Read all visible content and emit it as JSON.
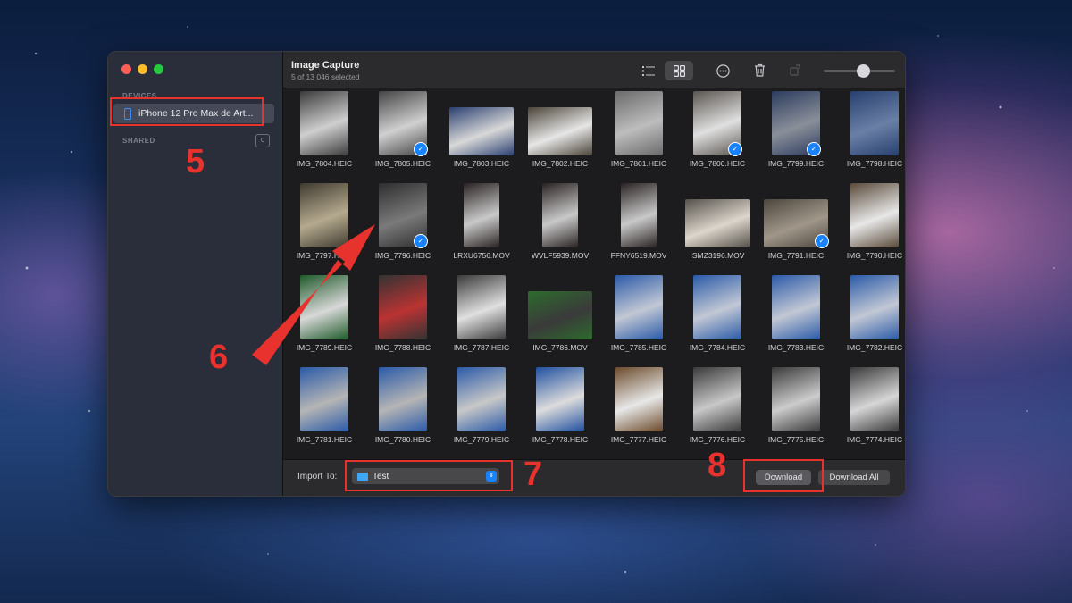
{
  "window": {
    "traffic_lights": [
      "#fe5f57",
      "#febc2e",
      "#28c840"
    ]
  },
  "sidebar": {
    "devices_header": "DEVICES",
    "device_name": "iPhone 12 Pro Max de Art...",
    "device_icon": "iphone-icon",
    "shared_header": "SHARED",
    "shared_count": "0"
  },
  "toolbar": {
    "title": "Image Capture",
    "subtitle": "5 of 13 046 selected",
    "icons": [
      "list-view-icon",
      "grid-view-icon",
      "more-icon",
      "trash-icon",
      "rotate-icon"
    ],
    "slider_level": 0.55
  },
  "accent": "#1a82ff",
  "photos": [
    {
      "label": "IMG_7804.HEIC",
      "selected": false,
      "shape": "portrait",
      "colors": [
        "#3b3b3b",
        "#cfcfcf"
      ]
    },
    {
      "label": "IMG_7805.HEIC",
      "selected": true,
      "shape": "portrait",
      "colors": [
        "#444",
        "#d0d0d0"
      ]
    },
    {
      "label": "IMG_7803.HEIC",
      "selected": false,
      "shape": "landscape",
      "colors": [
        "#2a3f70",
        "#d8d8d8"
      ]
    },
    {
      "label": "IMG_7802.HEIC",
      "selected": false,
      "shape": "landscape",
      "colors": [
        "#4a4338",
        "#e6e6e6"
      ]
    },
    {
      "label": "IMG_7801.HEIC",
      "selected": false,
      "shape": "portrait",
      "colors": [
        "#6a6a6a",
        "#bdbdbd"
      ]
    },
    {
      "label": "IMG_7800.HEIC",
      "selected": true,
      "shape": "portrait",
      "colors": [
        "#5a5550",
        "#e0e0e0"
      ]
    },
    {
      "label": "IMG_7799.HEIC",
      "selected": true,
      "shape": "portrait",
      "colors": [
        "#2c3c5e",
        "#8a8f99"
      ]
    },
    {
      "label": "IMG_7798.HEIC",
      "selected": false,
      "shape": "portrait",
      "colors": [
        "#27406e",
        "#6a7fa6"
      ]
    },
    {
      "label": "IMG_7797.HEIC",
      "selected": false,
      "shape": "portrait",
      "colors": [
        "#3f3a30",
        "#b5aa8f"
      ]
    },
    {
      "label": "IMG_7796.HEIC",
      "selected": true,
      "shape": "portrait",
      "colors": [
        "#2e2e2e",
        "#7a7a7a"
      ]
    },
    {
      "label": "LRXU6756.MOV",
      "selected": false,
      "shape": "tall",
      "colors": [
        "#2a2222",
        "#c9c9c9"
      ]
    },
    {
      "label": "WVLF5939.MOV",
      "selected": false,
      "shape": "tall",
      "colors": [
        "#2a2222",
        "#c9c9c9"
      ]
    },
    {
      "label": "FFNY6519.MOV",
      "selected": false,
      "shape": "tall",
      "colors": [
        "#2a2222",
        "#c9c9c9"
      ]
    },
    {
      "label": "ISMZ3196.MOV",
      "selected": false,
      "shape": "landscape",
      "colors": [
        "#55504a",
        "#dcd6cc"
      ]
    },
    {
      "label": "IMG_7791.HEIC",
      "selected": true,
      "shape": "landscape",
      "colors": [
        "#4c463d",
        "#a0978a"
      ]
    },
    {
      "label": "IMG_7790.HEIC",
      "selected": false,
      "shape": "portrait",
      "colors": [
        "#5a4a3a",
        "#e8e8e8"
      ]
    },
    {
      "label": "IMG_7789.HEIC",
      "selected": false,
      "shape": "portrait",
      "colors": [
        "#1e5a2a",
        "#d8d8d8"
      ]
    },
    {
      "label": "IMG_7788.HEIC",
      "selected": false,
      "shape": "portrait",
      "colors": [
        "#333",
        "#b33"
      ]
    },
    {
      "label": "IMG_7787.HEIC",
      "selected": false,
      "shape": "portrait",
      "colors": [
        "#3a3a3a",
        "#e0e0e0"
      ]
    },
    {
      "label": "IMG_7786.MOV",
      "selected": false,
      "shape": "landscape",
      "colors": [
        "#2d6b2d",
        "#3a3a3a"
      ]
    },
    {
      "label": "IMG_7785.HEIC",
      "selected": false,
      "shape": "portrait",
      "colors": [
        "#2b5aa8",
        "#c2c8d4"
      ]
    },
    {
      "label": "IMG_7784.HEIC",
      "selected": false,
      "shape": "portrait",
      "colors": [
        "#2b5aa8",
        "#c2c8d4"
      ]
    },
    {
      "label": "IMG_7783.HEIC",
      "selected": false,
      "shape": "portrait",
      "colors": [
        "#2b5aa8",
        "#c2c8d4"
      ]
    },
    {
      "label": "IMG_7782.HEIC",
      "selected": false,
      "shape": "portrait",
      "colors": [
        "#2b5aa8",
        "#c2c8d4"
      ]
    },
    {
      "label": "IMG_7781.HEIC",
      "selected": false,
      "shape": "portrait",
      "colors": [
        "#2b5aa8",
        "#b5b5b5"
      ]
    },
    {
      "label": "IMG_7780.HEIC",
      "selected": false,
      "shape": "portrait",
      "colors": [
        "#2b5aa8",
        "#b5b5b5"
      ]
    },
    {
      "label": "IMG_7779.HEIC",
      "selected": false,
      "shape": "portrait",
      "colors": [
        "#2b5aa8",
        "#c8c8c8"
      ]
    },
    {
      "label": "IMG_7778.HEIC",
      "selected": false,
      "shape": "portrait",
      "colors": [
        "#2050a0",
        "#dcdcdc"
      ]
    },
    {
      "label": "IMG_7777.HEIC",
      "selected": false,
      "shape": "portrait",
      "colors": [
        "#6b4a2a",
        "#e8e8e8"
      ]
    },
    {
      "label": "IMG_7776.HEIC",
      "selected": false,
      "shape": "portrait",
      "colors": [
        "#3a3a3a",
        "#c8c8c8"
      ]
    },
    {
      "label": "IMG_7775.HEIC",
      "selected": false,
      "shape": "portrait",
      "colors": [
        "#3a3a3a",
        "#cccccc"
      ]
    },
    {
      "label": "IMG_7774.HEIC",
      "selected": false,
      "shape": "portrait",
      "colors": [
        "#3a3a3a",
        "#d6d6d6"
      ]
    }
  ],
  "bottom": {
    "import_label": "Import To:",
    "import_folder": "Test",
    "download_label": "Download",
    "download_all_label": "Download All"
  },
  "annotations": {
    "n5": "5",
    "n6": "6",
    "n7": "7",
    "n8": "8",
    "color": "#e8322d"
  }
}
